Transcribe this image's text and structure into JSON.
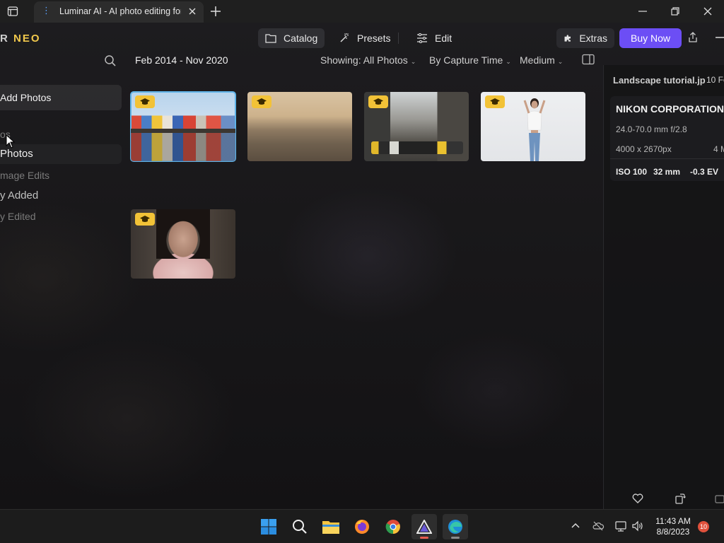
{
  "browser": {
    "tab_title": "Luminar AI - AI photo editing for",
    "tab_dots": "⋮"
  },
  "app": {
    "logo_main": "R ",
    "logo_accent": "NEO",
    "nav": {
      "catalog": "Catalog",
      "presets": "Presets",
      "edit": "Edit",
      "extras": "Extras",
      "buy_now": "Buy Now"
    },
    "toolbar": {
      "date_range": "Feb 2014 - Nov 2020",
      "showing": "Showing: All Photos",
      "sort": "By Capture Time",
      "size": "Medium"
    },
    "sidebar": {
      "add_photos": "Add Photos",
      "items": [
        {
          "label": "os"
        },
        {
          "label": " Photos"
        },
        {
          "label": "mage Edits"
        },
        {
          "label": "y Added"
        },
        {
          "label": "y Edited"
        }
      ]
    },
    "photos": [
      {
        "name": "harbor-houses",
        "selected": true
      },
      {
        "name": "beach-sunset",
        "selected": false
      },
      {
        "name": "city-street",
        "selected": false
      },
      {
        "name": "woman-white-background",
        "selected": false
      },
      {
        "name": "woman-portrait",
        "selected": false
      }
    ],
    "info_panel": {
      "filename": "Landscape tutorial.jp",
      "date": "10 Fe",
      "camera": "NIKON CORPORATION D",
      "lens": "24.0-70.0 mm f/2.8",
      "dimensions": "4000 x 2670px",
      "filesize": "4 M",
      "iso": "ISO 100",
      "focal": "32 mm",
      "ev": "-0.3 EV"
    }
  },
  "taskbar": {
    "time": "11:43 AM",
    "date": "8/8/2023",
    "notifications": "10"
  },
  "colors": {
    "accent_purple": "#6c4ef5",
    "badge_yellow": "#f2c237",
    "selection_blue": "#5fb3e8",
    "notification_red": "#e0513c"
  }
}
